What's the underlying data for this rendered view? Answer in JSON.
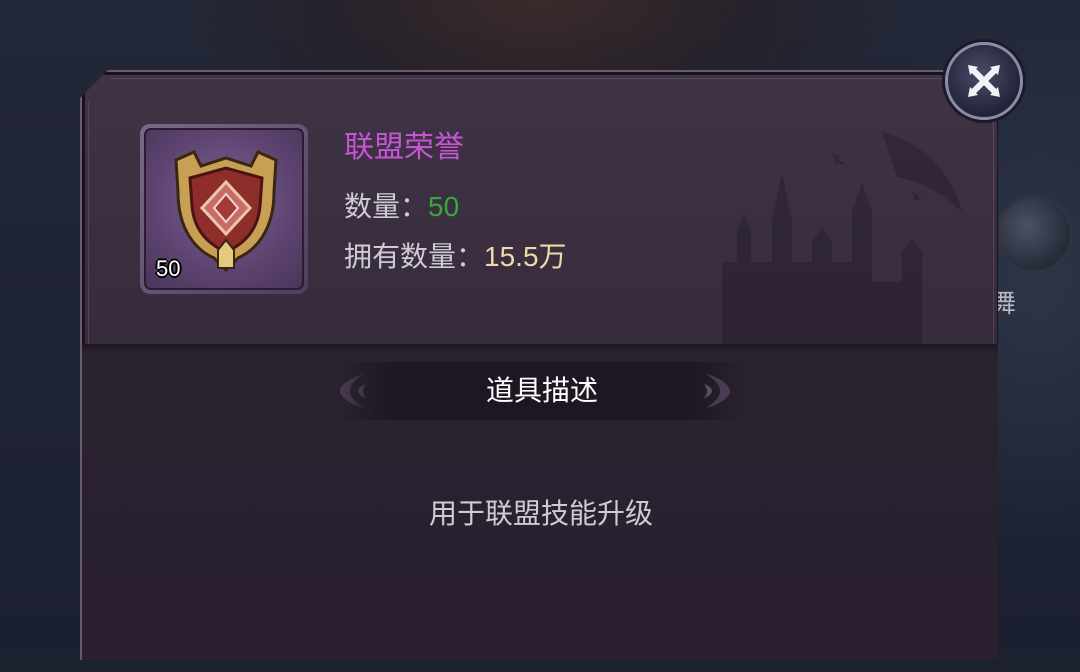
{
  "item": {
    "name": "联盟荣誉",
    "badge_count": "50",
    "quantity_label": "数量：",
    "quantity_value": "50",
    "owned_label": "拥有数量：",
    "owned_value": "15.5万",
    "icon": "alliance-honor-emblem-icon"
  },
  "section": {
    "title": "道具描述",
    "description": "用于联盟技能升级"
  },
  "background": {
    "side_text": "舞"
  },
  "colors": {
    "name": "#c655d6",
    "quantity": "#39a83a",
    "owned": "#f1d9a6",
    "panel": "#3f3345"
  }
}
